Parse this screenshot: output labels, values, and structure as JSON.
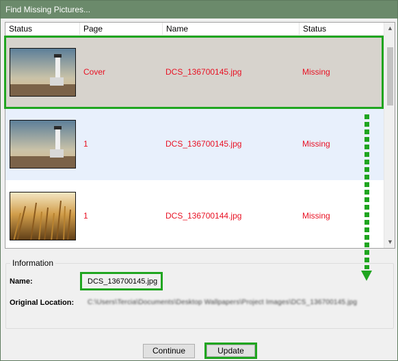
{
  "window": {
    "title": "Find Missing Pictures..."
  },
  "columns": [
    "Status",
    "Page",
    "Name",
    "Status"
  ],
  "rows": [
    {
      "thumbnail": "lighthouse-photo",
      "page": "Cover",
      "name": "DCS_136700145.jpg",
      "status": "Missing",
      "state": "selected"
    },
    {
      "thumbnail": "lighthouse-photo",
      "page": "1",
      "name": "DCS_136700145.jpg",
      "status": "Missing",
      "state": "hover"
    },
    {
      "thumbnail": "wheat-field-photo",
      "page": "1",
      "name": "DCS_136700144.jpg",
      "status": "Missing",
      "state": "normal"
    }
  ],
  "information": {
    "legend": "Information",
    "name_label": "Name:",
    "name_value": "DCS_136700145.jpg",
    "location_label": "Original Location:",
    "location_value": "C:\\Users\\Tercia\\Documents\\Desktop Wallpapers\\Project Images\\DCS_136700145.jpg"
  },
  "buttons": {
    "continue": "Continue",
    "update": "Update"
  },
  "colors": {
    "missing_text": "#e81123",
    "highlight": "#1fa51f",
    "titlebar": "#6b8a6b",
    "selected_row": "#d7d3cd"
  }
}
